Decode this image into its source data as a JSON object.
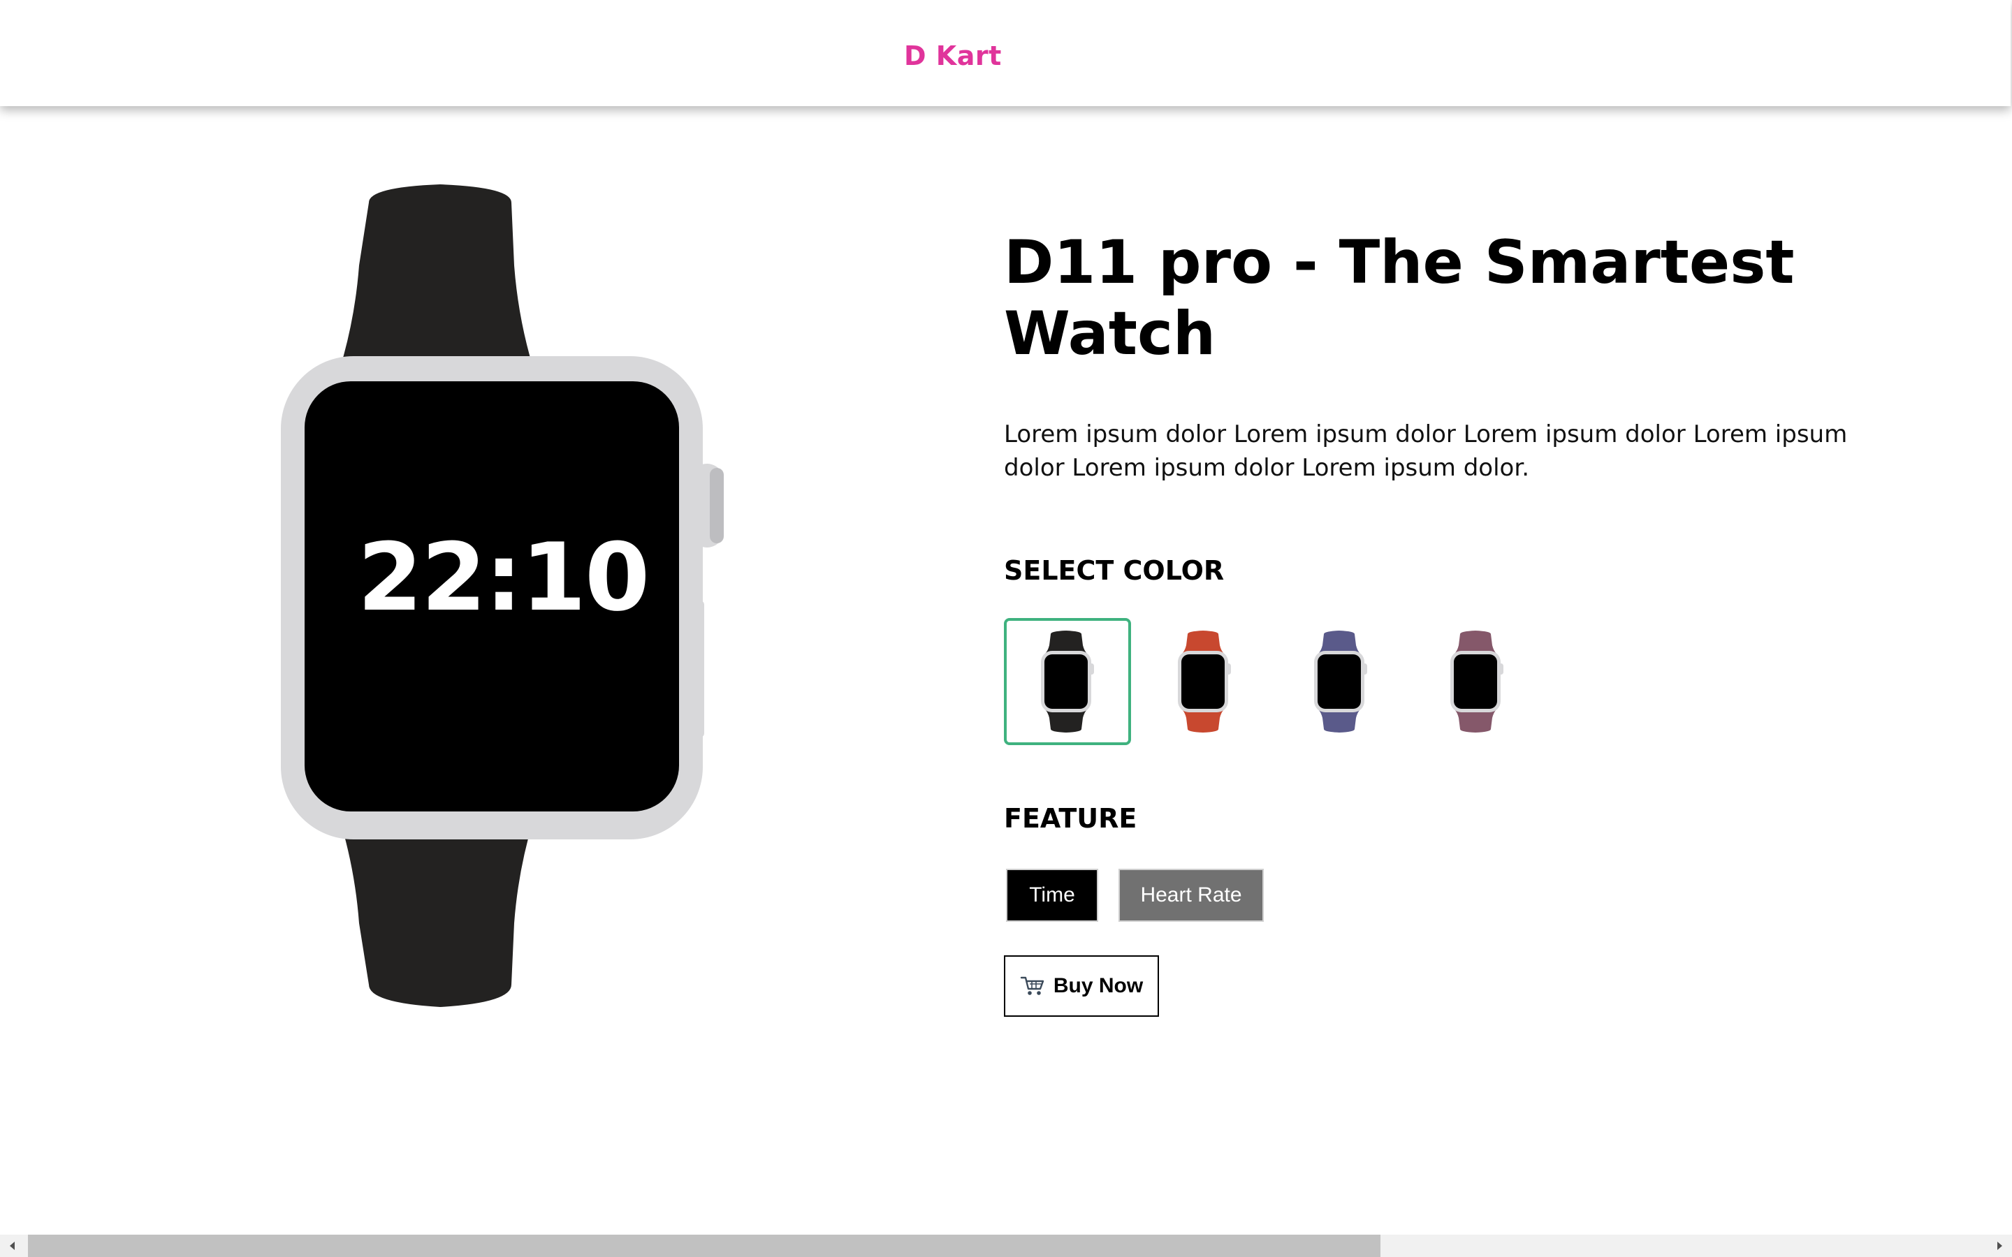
{
  "header": {
    "brand": "D Kart",
    "brand_color": "#e0349b"
  },
  "preview": {
    "time": "22:10",
    "band_color": "#232221",
    "case_color": "#d8d8da",
    "screen_color": "#000000"
  },
  "product": {
    "title": "D11 pro - The Smartest Watch",
    "description": "Lorem ipsum dolor Lorem ipsum dolor Lorem ipsum dolor Lorem ipsum dolor Lorem ipsum dolor Lorem ipsum dolor."
  },
  "color_section": {
    "label": "SELECT COLOR",
    "options": [
      {
        "name": "black",
        "band": "#232221",
        "selected": true
      },
      {
        "name": "red",
        "band": "#c8482f",
        "selected": false
      },
      {
        "name": "blue",
        "band": "#5a5a8a",
        "selected": false
      },
      {
        "name": "purple",
        "band": "#85586a",
        "selected": false
      }
    ],
    "selected_border_color": "#3fb27f"
  },
  "feature_section": {
    "label": "FEATURE",
    "buttons": [
      {
        "label": "Time",
        "active": true
      },
      {
        "label": "Heart Rate",
        "active": false
      }
    ]
  },
  "actions": {
    "buy_label": "Buy Now",
    "buy_icon": "cart-icon"
  }
}
